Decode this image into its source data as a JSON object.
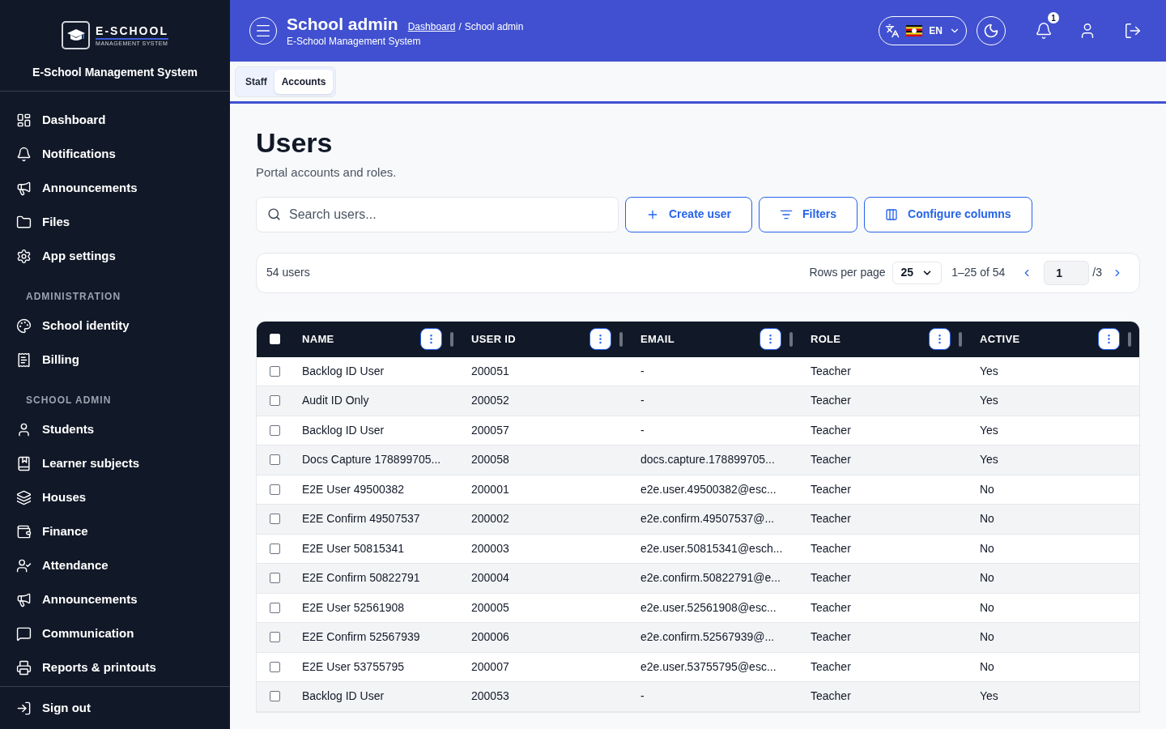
{
  "sidebar": {
    "logo": {
      "wordmark": "E-SCHOOL",
      "tagline": "MANAGEMENT SYSTEM"
    },
    "app_name": "E-School Management System",
    "sections": [
      {
        "items": [
          {
            "label": "Dashboard",
            "selected": false
          },
          {
            "label": "Notifications",
            "selected": false
          },
          {
            "label": "Announcements",
            "selected": false
          },
          {
            "label": "Files",
            "selected": false
          },
          {
            "label": "App settings",
            "selected": false
          }
        ]
      },
      {
        "heading": "ADMINISTRATION",
        "items": [
          {
            "label": "School identity",
            "selected": false
          },
          {
            "label": "Billing",
            "selected": false
          }
        ]
      },
      {
        "heading": "SCHOOL ADMIN",
        "items": [
          {
            "label": "Students",
            "selected": false
          },
          {
            "label": "Learner subjects",
            "selected": false
          },
          {
            "label": "Houses",
            "selected": false
          },
          {
            "label": "Finance",
            "selected": false
          },
          {
            "label": "Attendance",
            "selected": false
          },
          {
            "label": "Announcements",
            "selected": false
          },
          {
            "label": "Communication",
            "selected": false
          },
          {
            "label": "Reports & printouts",
            "selected": false
          }
        ]
      }
    ],
    "sign_out": "Sign out"
  },
  "header": {
    "title": "School admin",
    "breadcrumb": {
      "link": "Dashboard",
      "separator": "/",
      "current": "School admin"
    },
    "subtitle": "E-School Management System",
    "language": "EN",
    "notification_count": "1"
  },
  "tabs": [
    {
      "label": "Staff",
      "selected": false
    },
    {
      "label": "Accounts",
      "selected": true
    }
  ],
  "page": {
    "title": "Users",
    "subtitle": "Portal accounts and roles.",
    "search": {
      "placeholder": "Search users..."
    },
    "buttons": [
      "Create user",
      "Filters",
      "Configure columns"
    ],
    "pager": {
      "count": "54 users",
      "rows_label": "Rows per page",
      "rows_value": "25",
      "range": "1–25 of 54",
      "page": "1",
      "total_pages": "/3"
    }
  },
  "table": {
    "header_checked": false,
    "columns": [
      "NAME",
      "USER ID",
      "EMAIL",
      "ROLE",
      "ACTIVE"
    ],
    "rows": [
      {
        "selected": false,
        "cells": [
          "Backlog ID User",
          "200051",
          "-",
          "Teacher",
          "Yes"
        ]
      },
      {
        "selected": false,
        "cells": [
          "Audit ID Only",
          "200052",
          "-",
          "Teacher",
          "Yes"
        ]
      },
      {
        "selected": false,
        "cells": [
          "Backlog ID User",
          "200057",
          "-",
          "Teacher",
          "Yes"
        ]
      },
      {
        "selected": false,
        "cells": [
          "Docs Capture 178899705...",
          "200058",
          "docs.capture.178899705...",
          "Teacher",
          "Yes"
        ]
      },
      {
        "selected": false,
        "cells": [
          "E2E User 49500382",
          "200001",
          "e2e.user.49500382@esc...",
          "Teacher",
          "No"
        ]
      },
      {
        "selected": false,
        "cells": [
          "E2E Confirm 49507537",
          "200002",
          "e2e.confirm.49507537@...",
          "Teacher",
          "No"
        ]
      },
      {
        "selected": false,
        "cells": [
          "E2E User 50815341",
          "200003",
          "e2e.user.50815341@esch...",
          "Teacher",
          "No"
        ]
      },
      {
        "selected": false,
        "cells": [
          "E2E Confirm 50822791",
          "200004",
          "e2e.confirm.50822791@e...",
          "Teacher",
          "No"
        ]
      },
      {
        "selected": false,
        "cells": [
          "E2E User 52561908",
          "200005",
          "e2e.user.52561908@esc...",
          "Teacher",
          "No"
        ]
      },
      {
        "selected": false,
        "cells": [
          "E2E Confirm 52567939",
          "200006",
          "e2e.confirm.52567939@...",
          "Teacher",
          "No"
        ]
      },
      {
        "selected": false,
        "cells": [
          "E2E User 53755795",
          "200007",
          "e2e.user.53755795@esc...",
          "Teacher",
          "No"
        ]
      },
      {
        "selected": false,
        "cells": [
          "Backlog ID User",
          "200053",
          "-",
          "Teacher",
          "Yes"
        ]
      }
    ]
  }
}
